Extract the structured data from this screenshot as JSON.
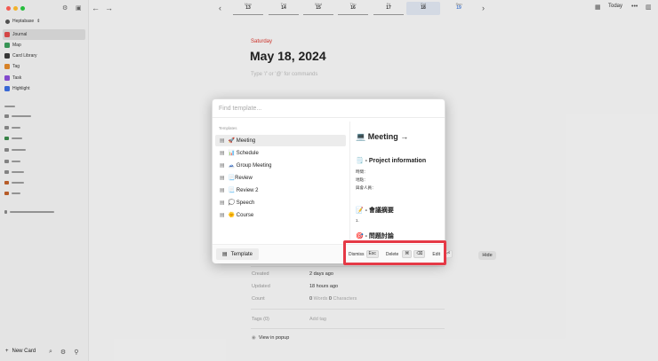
{
  "sidebar": {
    "workspace": "Heptabase",
    "nav": [
      {
        "label": "Journal",
        "color": "#e04a4a"
      },
      {
        "label": "Map",
        "color": "#3a9c5a"
      },
      {
        "label": "Card Library",
        "color": "#3a3a3a"
      },
      {
        "label": "Tag",
        "color": "#e38a2b"
      },
      {
        "label": "Task",
        "color": "#8a4ed8"
      },
      {
        "label": "Highlight",
        "color": "#3d6ee0"
      }
    ],
    "new_card": "New Card"
  },
  "topbar": {
    "week": [
      {
        "dow": "Mon",
        "num": "13"
      },
      {
        "dow": "Tue",
        "num": "14"
      },
      {
        "dow": "Wed",
        "num": "15"
      },
      {
        "dow": "Thu",
        "num": "16"
      },
      {
        "dow": "Fri",
        "num": "17"
      },
      {
        "dow": "Sat",
        "num": "18"
      },
      {
        "dow": "Sun",
        "num": "19"
      }
    ],
    "today": "Today"
  },
  "journal": {
    "weekday": "Saturday",
    "date": "May 18, 2024",
    "placeholder": "Type '/' or '@' for commands",
    "hide": "Hide",
    "props": [
      {
        "label": "Created",
        "value": "2 days ago",
        "extra": ""
      },
      {
        "label": "Updated",
        "value": "18 hours ago",
        "extra": ""
      },
      {
        "label": "Count",
        "value": "0",
        "extra": "Words",
        "value2": "0",
        "extra2": "Characters"
      }
    ],
    "tags_label": "Tags (0)",
    "add_tag": "Add tag",
    "view_popup": "View in popup"
  },
  "modal": {
    "search_placeholder": "Find template...",
    "section": "Templates",
    "templates": [
      "🚀 Meeting",
      "📊 Schedule",
      "🗻 Group Meeting",
      "📃Review",
      "📃 Review 2",
      "💭 Speech",
      "🌞 Course"
    ],
    "preview": {
      "title": "💻 Meeting →",
      "section1": "🗒️ - Project information",
      "lines1": [
        "時間：",
        "地點：",
        "與會人員："
      ],
      "section2": "📝 - 會議摘要",
      "line2": "1.",
      "section3": "🎯 - 問題討論"
    },
    "footer": {
      "template_btn": "Template",
      "dismiss": "Dismiss",
      "dismiss_key": "Esc",
      "delete": "Delete",
      "delete_key1": "⌘",
      "delete_key2": "⌫",
      "edit": "Edit",
      "edit_key": "⏎"
    }
  }
}
